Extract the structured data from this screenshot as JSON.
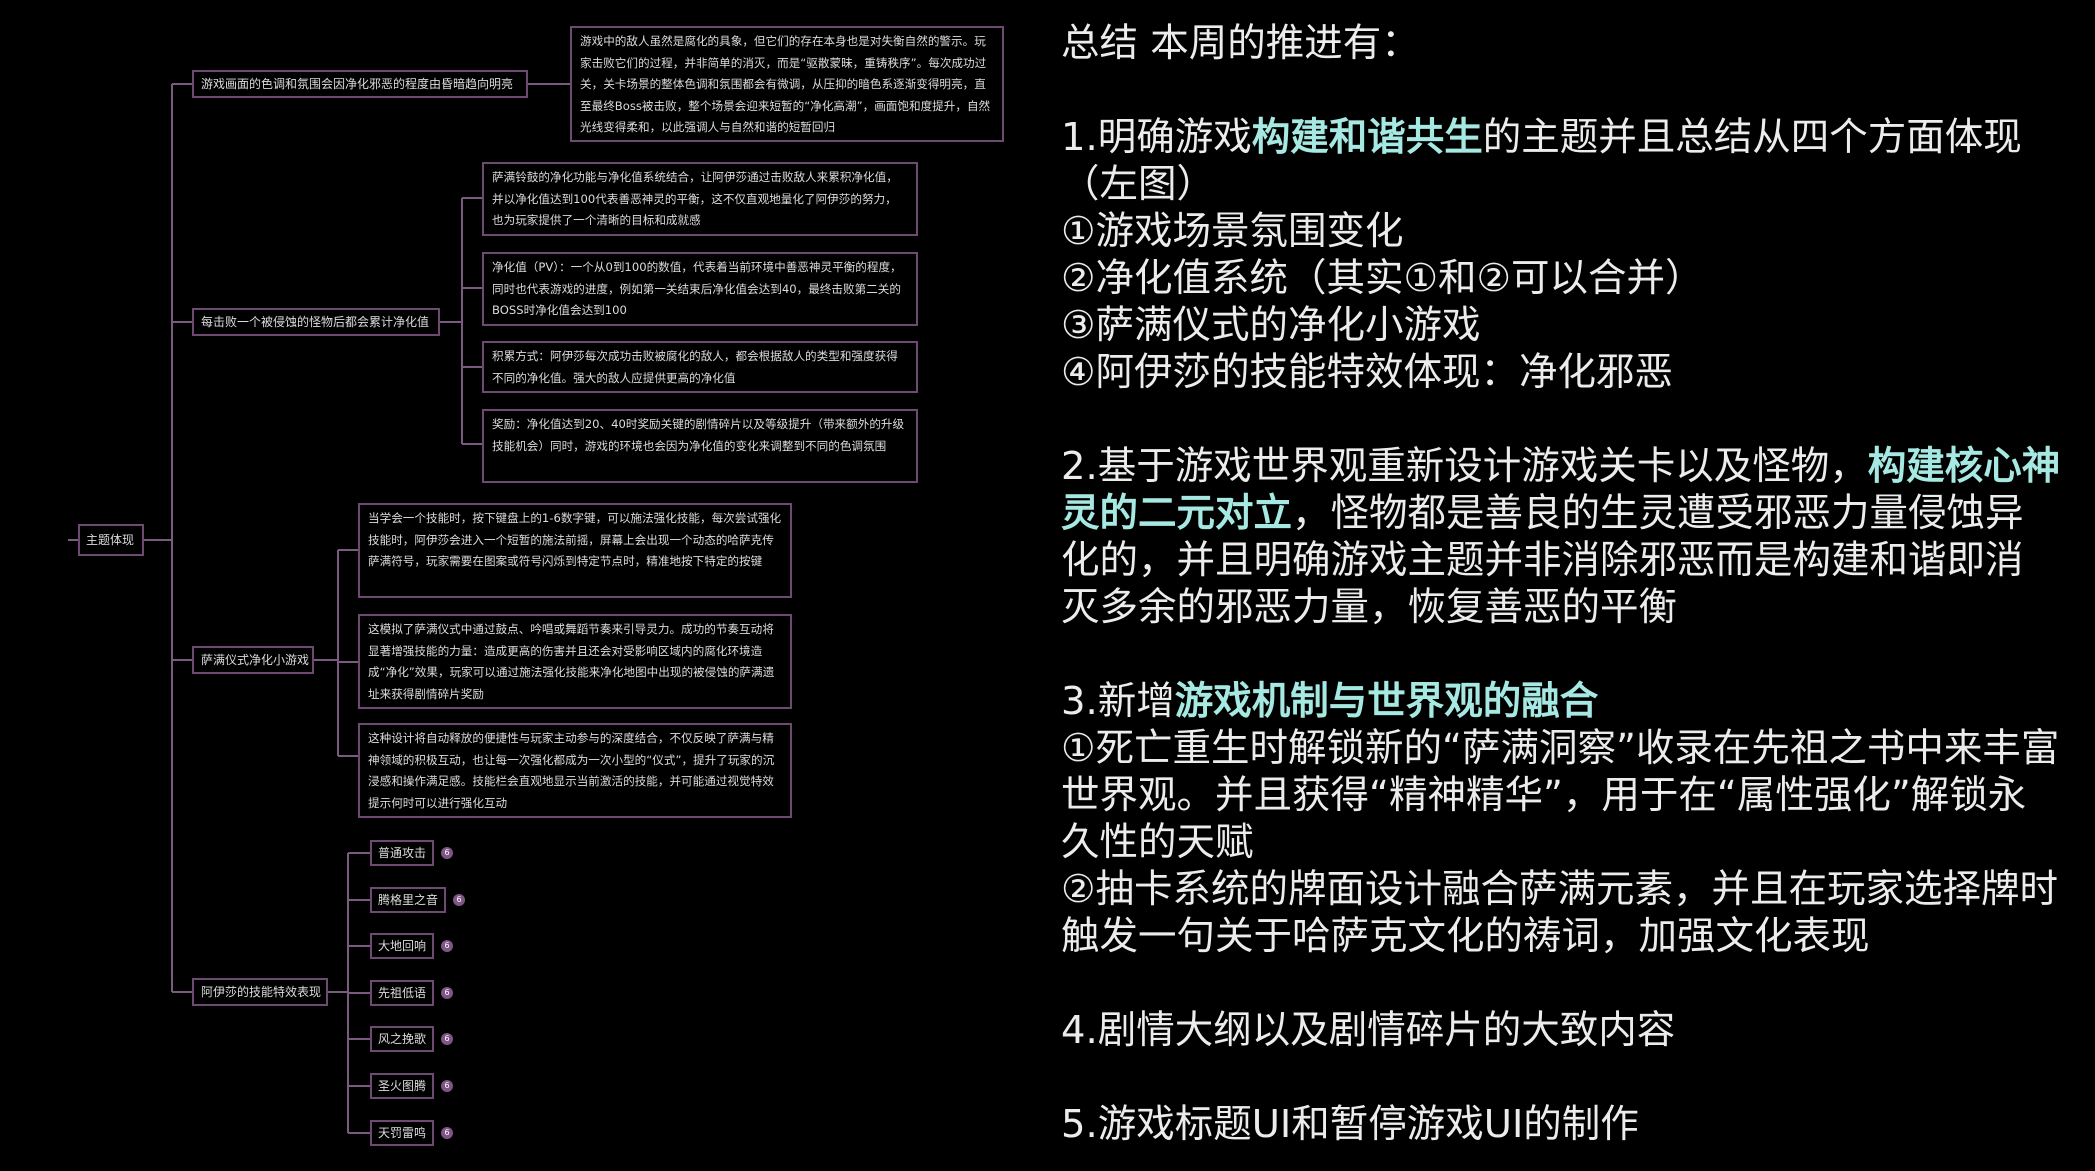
{
  "mindmap": {
    "root": "主题体现",
    "branches": [
      {
        "title": "游戏画面的色调和氛围会因净化邪恶的程度由昏暗趋向明亮",
        "details": [
          "游戏中的敌人虽然是腐化的具象，但它们的存在本身也是对失衡自然的警示。玩家击败它们的过程，并非简单的消灭，而是“驱散蒙昧，重铸秩序”。每次成功过关，关卡场景的整体色调和氛围都会有微调，从压抑的暗色系逐渐变得明亮，直至最终Boss被击败，整个场景会迎来短暂的“净化高潮”，画面饱和度提升，自然光线变得柔和，以此强调人与自然和谐的短暂回归"
        ]
      },
      {
        "title": "每击败一个被侵蚀的怪物后都会累计净化值",
        "details": [
          "萨满铃鼓的净化功能与净化值系统结合，让阿伊莎通过击败敌人来累积净化值，并以净化值达到100代表善恶神灵的平衡，这不仅直观地量化了阿伊莎的努力，也为玩家提供了一个清晰的目标和成就感",
          "净化值（PV）：一个从0到100的数值，代表着当前环境中善恶神灵平衡的程度，同时也代表游戏的进度，例如第一关结束后净化值会达到40，最终击败第二关的BOSS时净化值会达到100",
          "积累方式：阿伊莎每次成功击败被腐化的敌人，都会根据敌人的类型和强度获得不同的净化值。强大的敌人应提供更高的净化值",
          "奖励：净化值达到20、40时奖励关键的剧情碎片以及等级提升（带来额外的升级技能机会）同时，游戏的环境也会因为净化值的变化来调整到不同的色调氛围"
        ]
      },
      {
        "title": "萨满仪式净化小游戏",
        "details": [
          "当学会一个技能时，按下键盘上的1-6数字键，可以施法强化技能，每次尝试强化技能时，阿伊莎会进入一个短暂的施法前摇，屏幕上会出现一个动态的哈萨克传萨满符号，玩家需要在图案或符号闪烁到特定节点时，精准地按下特定的按键",
          "这模拟了萨满仪式中通过鼓点、吟唱或舞蹈节奏来引导灵力。成功的节奏互动将显著增强技能的力量：造成更高的伤害并且还会对受影响区域内的腐化环境造成“净化”效果，玩家可以通过施法强化技能来净化地图中出现的被侵蚀的萨满遗址来获得剧情碎片奖励",
          "这种设计将自动释放的便捷性与玩家主动参与的深度结合，不仅反映了萨满与精神领域的积极互动，也让每一次强化都成为一次小型的“仪式”，提升了玩家的沉浸感和操作满足感。技能栏会直观地显示当前激活的技能，并可能通过视觉特效提示何时可以进行强化互动"
        ]
      },
      {
        "title": "阿伊莎的技能特效表现",
        "skills": [
          "普通攻击",
          "腾格里之音",
          "大地回响",
          "先祖低语",
          "风之挽歌",
          "圣火图腾",
          "天罚雷鸣"
        ],
        "badge": "6"
      }
    ]
  },
  "summary": {
    "heading": "总结 本周的推进有：",
    "s1": {
      "pre": "1.明确游戏",
      "hl": "构建和谐共生",
      "post": "的主题并且总结从四个方面体现（左图）",
      "items": [
        "①游戏场景氛围变化",
        "②净化值系统（其实①和②可以合并）",
        "③萨满仪式的净化小游戏",
        "④阿伊莎的技能特效体现：净化邪恶"
      ]
    },
    "s2": {
      "pre": "2.基于游戏世界观重新设计游戏关卡以及怪物，",
      "hl": "构建核心神灵的二元对立",
      "post": "，怪物都是善良的生灵遭受邪恶力量侵蚀异化的，并且明确游戏主题并非消除邪恶而是构建和谐即消灭多余的邪恶力量，恢复善恶的平衡"
    },
    "s3": {
      "pre": "3.新增",
      "hl": "游戏机制与世界观的融合",
      "items": [
        "①死亡重生时解锁新的“萨满洞察”收录在先祖之书中来丰富世界观。并且获得“精神精华”，用于在“属性强化”解锁永久性的天赋",
        "②抽卡系统的牌面设计融合萨满元素，并且在玩家选择牌时触发一句关于哈萨克文化的祷词，加强文化表现"
      ]
    },
    "s4": "4.剧情大纲以及剧情碎片的大致内容",
    "s5": "5.游戏标题UI和暂停游戏UI的制作"
  }
}
